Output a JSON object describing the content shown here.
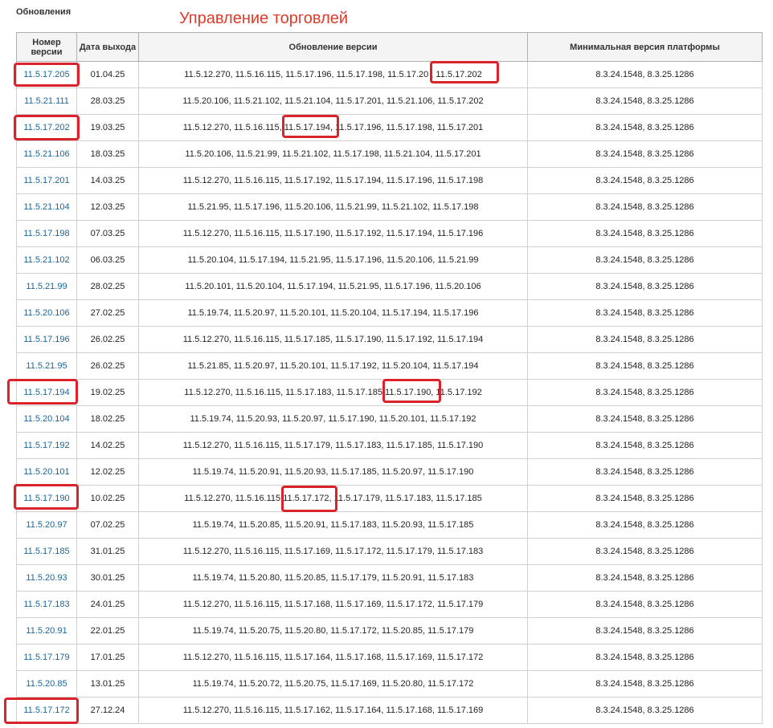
{
  "section_title": "Обновления",
  "overlay_title": "Управление торговлей",
  "table": {
    "headers": {
      "version": "Номер версии",
      "date": "Дата выхода",
      "update_from": "Обновление версии",
      "min_platform": "Минимальная версия платформы"
    },
    "rows": [
      {
        "version": "11.5.17.205",
        "date": "01.04.25",
        "update_from": "11.5.12.270, 11.5.16.115, 11.5.17.196, 11.5.17.198, 11.5.17.20 , 11.5.17.202",
        "min_platform": "8.3.24.1548, 8.3.25.1286"
      },
      {
        "version": "11.5.21.111",
        "date": "28.03.25",
        "update_from": "11.5.20.106, 11.5.21.102, 11.5.21.104, 11.5.17.201, 11.5.21.106, 11.5.17.202",
        "min_platform": "8.3.24.1548, 8.3.25.1286"
      },
      {
        "version": "11.5.17.202",
        "date": "19.03.25",
        "update_from": "11.5.12.270, 11.5.16.115, 11.5.17.194, 11.5.17.196, 11.5.17.198, 11.5.17.201",
        "min_platform": "8.3.24.1548, 8.3.25.1286"
      },
      {
        "version": "11.5.21.106",
        "date": "18.03.25",
        "update_from": "11.5.20.106, 11.5.21.99, 11.5.21.102, 11.5.17.198, 11.5.21.104, 11.5.17.201",
        "min_platform": "8.3.24.1548, 8.3.25.1286"
      },
      {
        "version": "11.5.17.201",
        "date": "14.03.25",
        "update_from": "11.5.12.270, 11.5.16.115, 11.5.17.192, 11.5.17.194, 11.5.17.196, 11.5.17.198",
        "min_platform": "8.3.24.1548, 8.3.25.1286"
      },
      {
        "version": "11.5.21.104",
        "date": "12.03.25",
        "update_from": "11.5.21.95, 11.5.17.196, 11.5.20.106, 11.5.21.99, 11.5.21.102, 11.5.17.198",
        "min_platform": "8.3.24.1548, 8.3.25.1286"
      },
      {
        "version": "11.5.17.198",
        "date": "07.03.25",
        "update_from": "11.5.12.270, 11.5.16.115, 11.5.17.190, 11.5.17.192, 11.5.17.194, 11.5.17.196",
        "min_platform": "8.3.24.1548, 8.3.25.1286"
      },
      {
        "version": "11.5.21.102",
        "date": "06.03.25",
        "update_from": "11.5.20.104, 11.5.17.194, 11.5.21.95, 11.5.17.196, 11.5.20.106, 11.5.21.99",
        "min_platform": "8.3.24.1548, 8.3.25.1286"
      },
      {
        "version": "11.5.21.99",
        "date": "28.02.25",
        "update_from": "11.5.20.101, 11.5.20.104, 11.5.17.194, 11.5.21.95, 11.5.17.196, 11.5.20.106",
        "min_platform": "8.3.24.1548, 8.3.25.1286"
      },
      {
        "version": "11.5.20.106",
        "date": "27.02.25",
        "update_from": "11.5.19.74, 11.5.20.97, 11.5.20.101, 11.5.20.104, 11.5.17.194, 11.5.17.196",
        "min_platform": "8.3.24.1548, 8.3.25.1286"
      },
      {
        "version": "11.5.17.196",
        "date": "26.02.25",
        "update_from": "11.5.12.270, 11.5.16.115, 11.5.17.185, 11.5.17.190, 11.5.17.192, 11.5.17.194",
        "min_platform": "8.3.24.1548, 8.3.25.1286"
      },
      {
        "version": "11.5.21.95",
        "date": "26.02.25",
        "update_from": "11.5.21.85, 11.5.20.97, 11.5.20.101, 11.5.17.192, 11.5.20.104, 11.5.17.194",
        "min_platform": "8.3.24.1548, 8.3.25.1286"
      },
      {
        "version": "11.5.17.194",
        "date": "19.02.25",
        "update_from": "11.5.12.270, 11.5.16.115, 11.5.17.183, 11.5.17.185 11.5.17.190, 11.5.17.192",
        "min_platform": "8.3.24.1548, 8.3.25.1286"
      },
      {
        "version": "11.5.20.104",
        "date": "18.02.25",
        "update_from": "11.5.19.74, 11.5.20.93, 11.5.20.97, 11.5.17.190, 11.5.20.101, 11.5.17.192",
        "min_platform": "8.3.24.1548, 8.3.25.1286"
      },
      {
        "version": "11.5.17.192",
        "date": "14.02.25",
        "update_from": "11.5.12.270, 11.5.16.115, 11.5.17.179, 11.5.17.183, 11.5.17.185, 11.5.17.190",
        "min_platform": "8.3.24.1548, 8.3.25.1286"
      },
      {
        "version": "11.5.20.101",
        "date": "12.02.25",
        "update_from": "11.5.19.74, 11.5.20.91, 11.5.20.93, 11.5.17.185, 11.5.20.97, 11.5.17.190",
        "min_platform": "8.3.24.1548, 8.3.25.1286"
      },
      {
        "version": "11.5.17.190",
        "date": "10.02.25",
        "update_from": "11.5.12.270, 11.5.16.115 11.5.17.172, 11.5.17.179, 11.5.17.183, 11.5.17.185",
        "min_platform": "8.3.24.1548, 8.3.25.1286"
      },
      {
        "version": "11.5.20.97",
        "date": "07.02.25",
        "update_from": "11.5.19.74, 11.5.20.85, 11.5.20.91, 11.5.17.183, 11.5.20.93, 11.5.17.185",
        "min_platform": "8.3.24.1548, 8.3.25.1286"
      },
      {
        "version": "11.5.17.185",
        "date": "31.01.25",
        "update_from": "11.5.12.270, 11.5.16.115, 11.5.17.169, 11.5.17.172, 11.5.17.179, 11.5.17.183",
        "min_platform": "8.3.24.1548, 8.3.25.1286"
      },
      {
        "version": "11.5.20.93",
        "date": "30.01.25",
        "update_from": "11.5.19.74, 11.5.20.80, 11.5.20.85, 11.5.17.179, 11.5.20.91, 11.5.17.183",
        "min_platform": "8.3.24.1548, 8.3.25.1286"
      },
      {
        "version": "11.5.17.183",
        "date": "24.01.25",
        "update_from": "11.5.12.270, 11.5.16.115, 11.5.17.168, 11.5.17.169, 11.5.17.172, 11.5.17.179",
        "min_platform": "8.3.24.1548, 8.3.25.1286"
      },
      {
        "version": "11.5.20.91",
        "date": "22.01.25",
        "update_from": "11.5.19.74, 11.5.20.75, 11.5.20.80, 11.5.17.172, 11.5.20.85, 11.5.17.179",
        "min_platform": "8.3.24.1548, 8.3.25.1286"
      },
      {
        "version": "11.5.17.179",
        "date": "17.01.25",
        "update_from": "11.5.12.270, 11.5.16.115, 11.5.17.164, 11.5.17.168, 11.5.17.169, 11.5.17.172",
        "min_platform": "8.3.24.1548, 8.3.25.1286"
      },
      {
        "version": "11.5.20.85",
        "date": "13.01.25",
        "update_from": "11.5.19.74, 11.5.20.72, 11.5.20.75, 11.5.17.169, 11.5.20.80, 11.5.17.172",
        "min_platform": "8.3.24.1548, 8.3.25.1286"
      },
      {
        "version": "11.5.17.172",
        "date": "27.12.24",
        "update_from": "11.5.12.270, 11.5.16.115, 11.5.17.162, 11.5.17.164, 11.5.17.168, 11.5.17.169",
        "min_platform": "8.3.24.1548, 8.3.25.1286"
      }
    ]
  },
  "highlight_color": "#d9232d",
  "link_color": "#1a6699"
}
